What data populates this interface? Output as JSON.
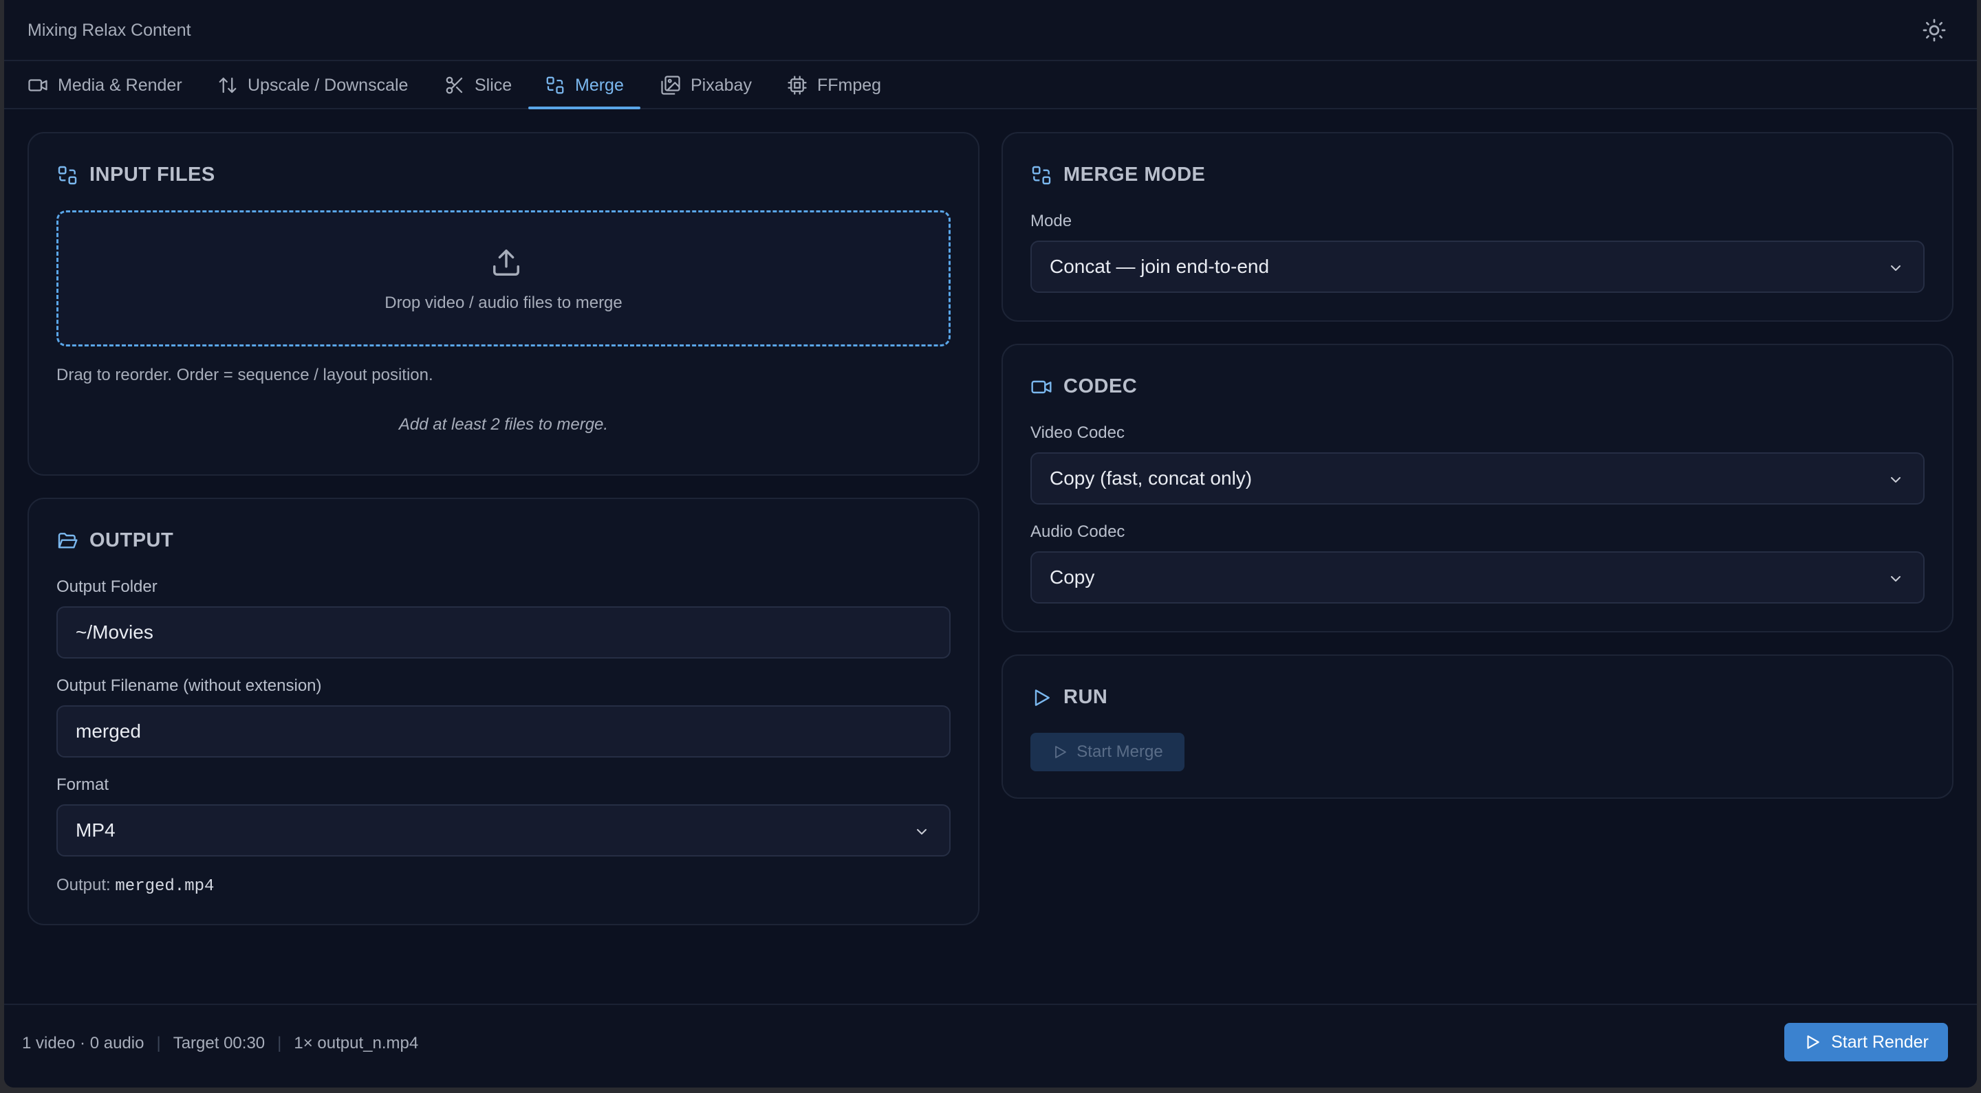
{
  "app": {
    "title": "Mixing Relax Content"
  },
  "tabs": [
    {
      "label": "Media & Render",
      "icon": "video-icon"
    },
    {
      "label": "Upscale / Downscale",
      "icon": "arrows-up-down-icon"
    },
    {
      "label": "Slice",
      "icon": "scissors-icon"
    },
    {
      "label": "Merge",
      "icon": "merge-icon",
      "active": true
    },
    {
      "label": "Pixabay",
      "icon": "images-icon"
    },
    {
      "label": "FFmpeg",
      "icon": "cpu-icon"
    }
  ],
  "input_files": {
    "title": "INPUT FILES",
    "drop_text": "Drop video / audio files to merge",
    "hint": "Drag to reorder. Order = sequence / layout position.",
    "empty": "Add at least 2 files to merge."
  },
  "output": {
    "title": "OUTPUT",
    "folder_label": "Output Folder",
    "folder_value": "~/Movies",
    "filename_label": "Output Filename (without extension)",
    "filename_value": "merged",
    "format_label": "Format",
    "format_value": "MP4",
    "output_prefix": "Output:",
    "output_file": "merged.mp4"
  },
  "merge_mode": {
    "title": "MERGE MODE",
    "mode_label": "Mode",
    "mode_value": "Concat — join end-to-end"
  },
  "codec": {
    "title": "CODEC",
    "video_label": "Video Codec",
    "video_value": "Copy (fast, concat only)",
    "audio_label": "Audio Codec",
    "audio_value": "Copy"
  },
  "run": {
    "title": "RUN",
    "start_merge": "Start Merge"
  },
  "footer": {
    "media_count": "1 video · 0 audio",
    "target": "Target 00:30",
    "outputs": "1× output_n.mp4",
    "start_render": "Start Render"
  },
  "colors": {
    "accent": "#5aa6e8",
    "background": "#0c1120",
    "card": "#0e1424",
    "button": "#3b82cf"
  }
}
